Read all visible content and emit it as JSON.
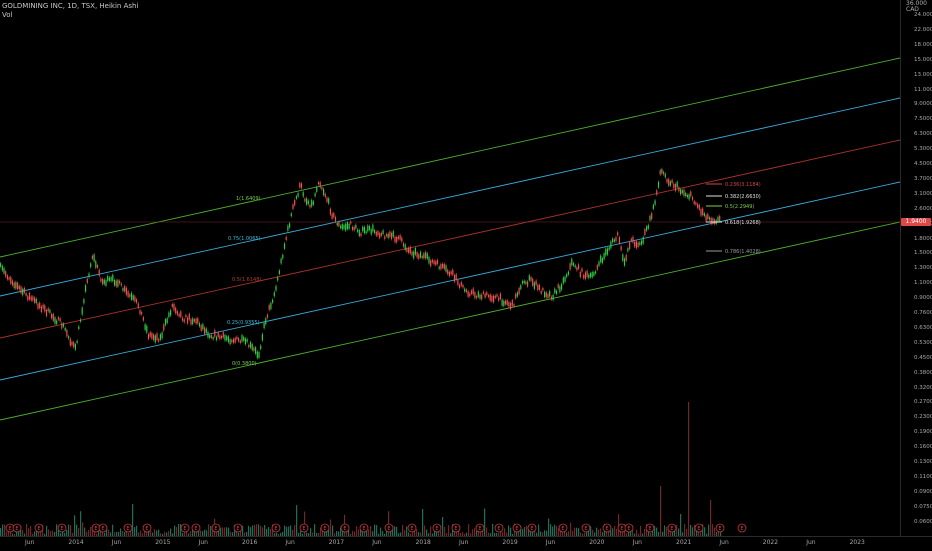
{
  "header": {
    "symbol_line": "GOLDMINING INC, 1D, TSX, Heikin Ashi",
    "volume_label": "Vol"
  },
  "price_axis": {
    "currency_top": "36.000",
    "currency": "CAD",
    "labels": [
      "24.000",
      "22.000",
      "18.000",
      "15.000",
      "13.0000",
      "11.0000",
      "9.0000",
      "7.5000",
      "6.3000",
      "5.3000",
      "4.5000",
      "3.7000",
      "3.1000",
      "2.6000",
      "2.2000",
      "1.8000",
      "1.5000",
      "1.3000",
      "1.1000",
      "0.9000",
      "0.7600",
      "0.6300",
      "0.5300",
      "0.4500",
      "0.3800",
      "0.3200",
      "0.2700",
      "0.2300",
      "0.1900",
      "0.1600",
      "0.1300",
      "0.1100",
      "0.0900",
      "0.0750",
      "0.0600"
    ],
    "last_price": "1.9400"
  },
  "time_axis": {
    "labels": [
      "Jun",
      "2014",
      "Jun",
      "2015",
      "Jun",
      "2016",
      "Jun",
      "2017",
      "Jun",
      "2018",
      "Jun",
      "2019",
      "Jun",
      "2020",
      "Jun",
      "2021",
      "Jun",
      "2022",
      "Jun",
      "2023"
    ]
  },
  "events": {
    "marker_letter": "E"
  },
  "pitchfork_labels": [
    {
      "text": "1(1.6409)",
      "color": "#7bd14a"
    },
    {
      "text": "0.75(1.0065)",
      "color": "#41b8d8"
    },
    {
      "text": "0.5(1.6148)",
      "color": "#b83c30"
    },
    {
      "text": "0.25(0.9355)",
      "color": "#41b8d8"
    },
    {
      "text": "0(0.3800)",
      "color": "#7bd14a"
    }
  ],
  "fib_labels": [
    {
      "text": "0.236(3.1184)",
      "color": "#d04840"
    },
    {
      "text": "0.382(2.6630)",
      "color": "#e0e0e0"
    },
    {
      "text": "0.5(2.2949)",
      "color": "#7bd14a"
    },
    {
      "text": "0.618(1.9268)",
      "color": "#e0e0e0"
    },
    {
      "text": "0.786(1.4028)",
      "color": "#9a9a9a"
    }
  ],
  "colors": {
    "up": "#26a69a",
    "up_candle": "#33cc44",
    "down": "#ef5350",
    "channel_outer": "#4caf30",
    "channel_inner": "#3aa8d8",
    "median": "#a8342c"
  }
}
